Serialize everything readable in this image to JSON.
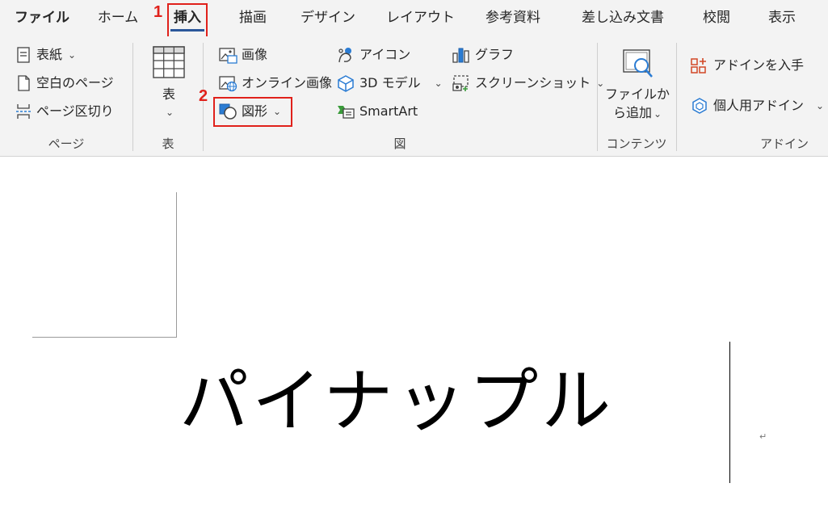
{
  "tabs": [
    {
      "label": "ファイル"
    },
    {
      "label": "ホーム"
    },
    {
      "label": "挿入"
    },
    {
      "label": "描画"
    },
    {
      "label": "デザイン"
    },
    {
      "label": "レイアウト"
    },
    {
      "label": "参考資料"
    },
    {
      "label": "差し込み文書"
    },
    {
      "label": "校閲"
    },
    {
      "label": "表示"
    }
  ],
  "annotations": {
    "step1": "1",
    "step2": "2"
  },
  "ribbon": {
    "page_group": {
      "label": "ページ",
      "cover": "表紙",
      "blank": "空白のページ",
      "break": "ページ区切り"
    },
    "table_group": {
      "label": "表",
      "table": "表"
    },
    "illustrations_group": {
      "label": "図",
      "pictures": "画像",
      "online_pictures": "オンライン画像",
      "shapes": "図形",
      "icons": "アイコン",
      "models_3d": "3D モデル",
      "smartart": "SmartArt",
      "chart": "グラフ",
      "screenshot": "スクリーンショット"
    },
    "content_group": {
      "label": "コンテンツ",
      "add_file_line1": "ファイルか",
      "add_file_line2": "ら追加"
    },
    "addins_group": {
      "label": "アドイン",
      "get_addins": "アドインを入手",
      "my_addins": "個人用アドイン"
    }
  },
  "document": {
    "text": "パイナップル",
    "para_mark": "↵"
  },
  "colors": {
    "accent": "#2b579a",
    "highlight": "#e0211b",
    "icon_blue": "#2b7cd3",
    "icon_orange": "#d24726"
  }
}
